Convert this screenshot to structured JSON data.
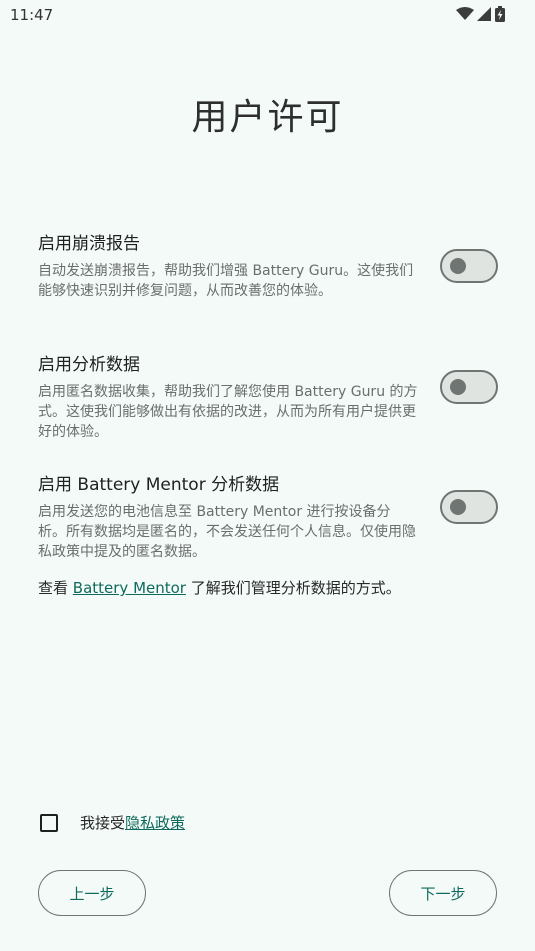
{
  "status_bar": {
    "time": "11:47",
    "icons": [
      "wifi-icon",
      "signal-icon",
      "battery-charging-icon"
    ]
  },
  "title": "用户许可",
  "settings": [
    {
      "title": "启用崩溃报告",
      "description": "自动发送崩溃报告，帮助我们增强 Battery Guru。这使我们能够快速识别并修复问题，从而改善您的体验。",
      "enabled": false
    },
    {
      "title": "启用分析数据",
      "description": "启用匿名数据收集，帮助我们了解您使用 Battery Guru 的方式。这使我们能够做出有依据的改进，从而为所有用户提供更好的体验。",
      "enabled": false
    },
    {
      "title": "启用 Battery Mentor 分析数据",
      "description": "启用发送您的电池信息至 Battery Mentor 进行按设备分析。所有数据均是匿名的，不会发送任何个人信息。仅使用隐私政策中提及的匿名数据。",
      "enabled": false
    }
  ],
  "info": {
    "prefix": "查看 ",
    "link": "Battery Mentor",
    "suffix": " 了解我们管理分析数据的方式。"
  },
  "consent": {
    "checked": false,
    "prefix": "我接受",
    "link": "隐私政策"
  },
  "buttons": {
    "back": "上一步",
    "next": "下一步"
  },
  "colors": {
    "background": "#f4faf7",
    "accent": "#0f6a5e",
    "toggle_outline": "#6f7572"
  }
}
